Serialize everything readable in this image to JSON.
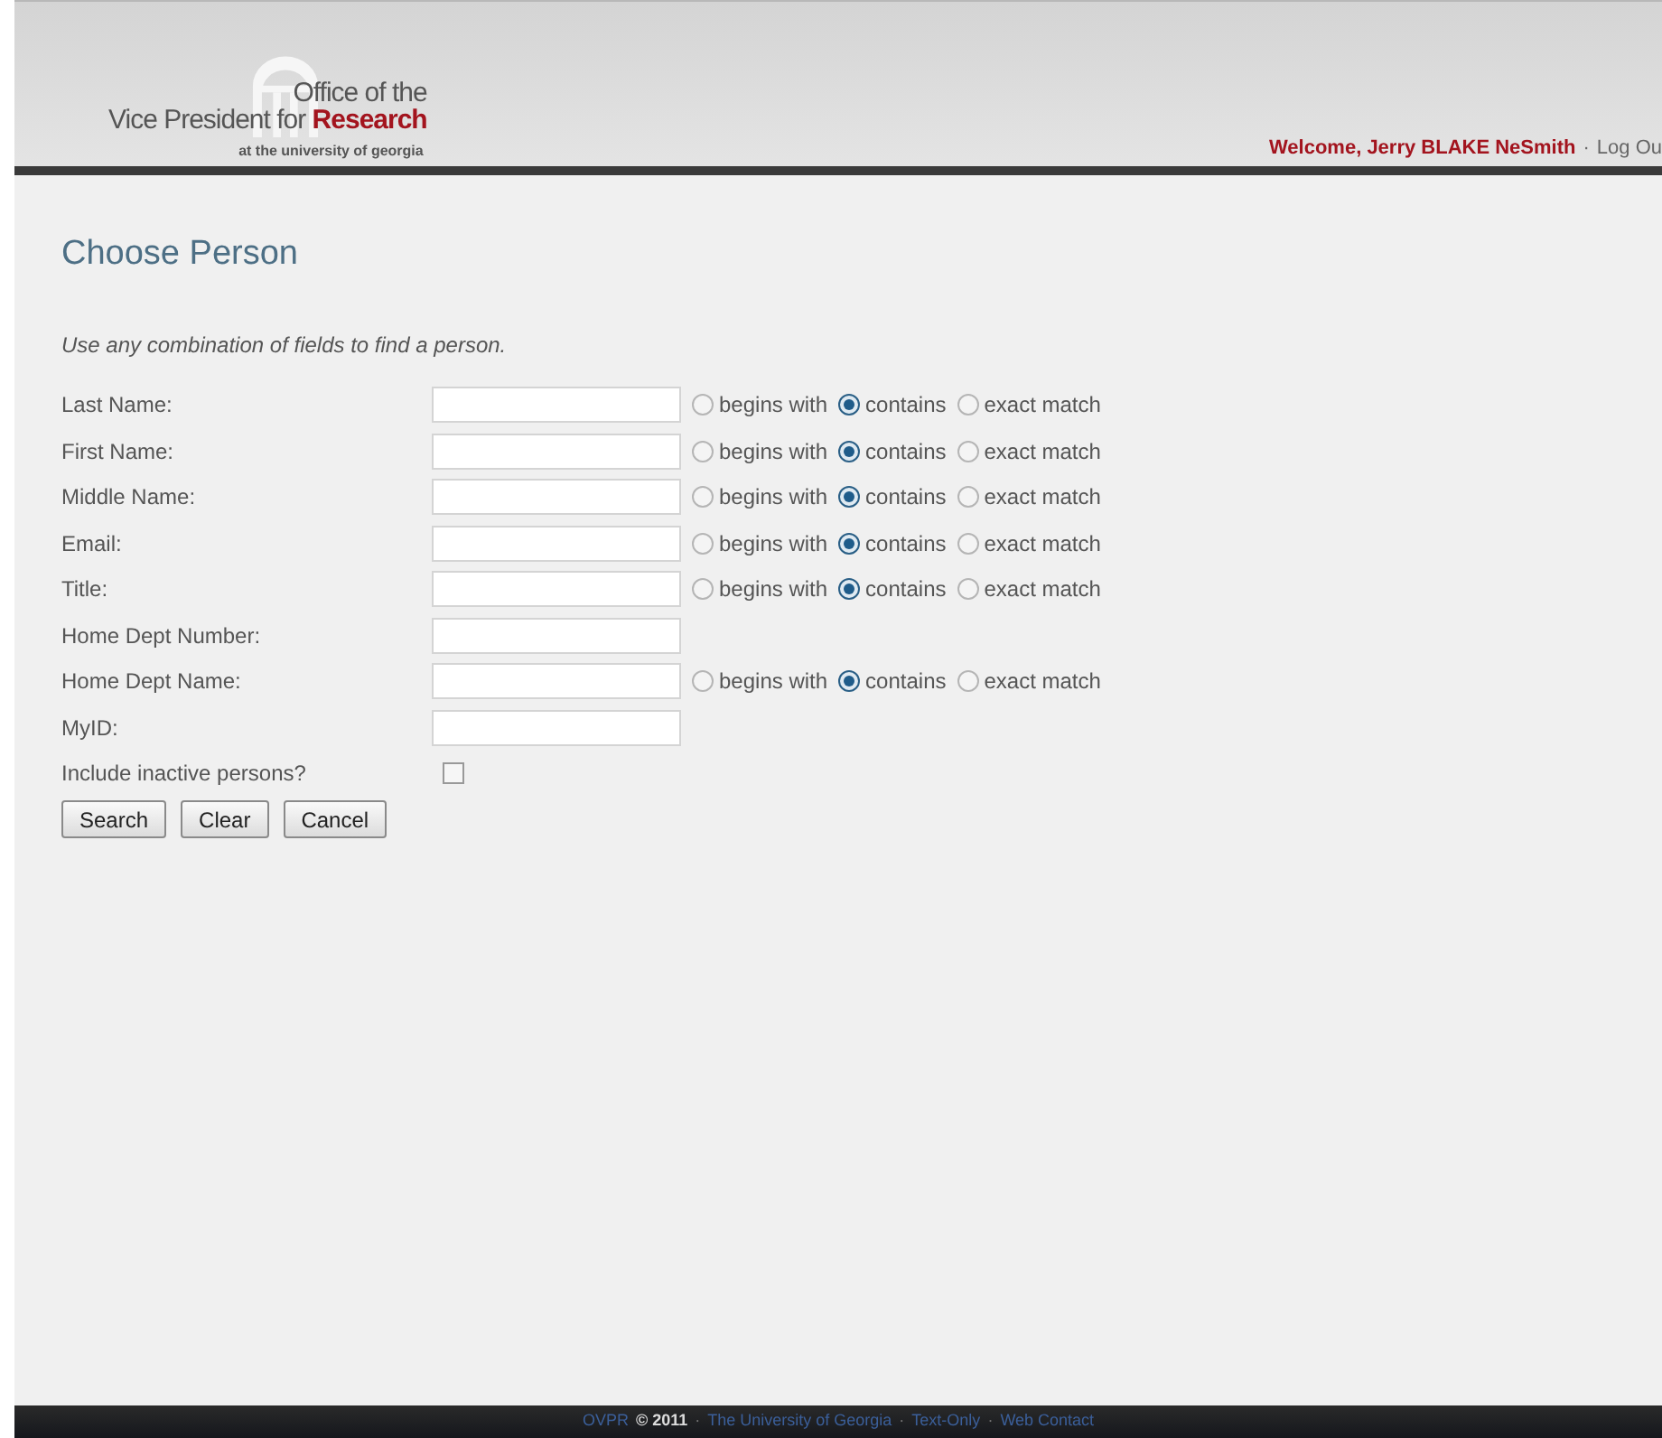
{
  "header": {
    "logo": {
      "line1": "Office of the",
      "line2": "Vice President for **Research**",
      "line3": "at the university of georgia"
    },
    "welcome": "Welcome, Jerry BLAKE NeSmith",
    "separator": "·",
    "logout": "Log Ou"
  },
  "title": "Choose Person",
  "intro": "Use any combination of fields to find a person.",
  "fields": [
    {
      "label": "Last Name:",
      "kind": "text",
      "options": [
        {
          "label": "begins with",
          "selected": false
        },
        {
          "label": "contains",
          "selected": true
        },
        {
          "label": "exact match",
          "selected": false
        }
      ]
    },
    {
      "label": "First Name:",
      "kind": "text",
      "options": [
        {
          "label": "begins with",
          "selected": false
        },
        {
          "label": "contains",
          "selected": true
        },
        {
          "label": "exact match",
          "selected": false
        }
      ]
    },
    {
      "label": "Middle Name:",
      "kind": "text",
      "options": [
        {
          "label": "begins with",
          "selected": false
        },
        {
          "label": "contains",
          "selected": true
        },
        {
          "label": "exact match",
          "selected": false
        }
      ]
    },
    {
      "label": "Email:",
      "kind": "text",
      "options": [
        {
          "label": "begins with",
          "selected": false
        },
        {
          "label": "contains",
          "selected": true
        },
        {
          "label": "exact match",
          "selected": false
        }
      ]
    },
    {
      "label": "Title:",
      "kind": "text",
      "options": [
        {
          "label": "begins with",
          "selected": false
        },
        {
          "label": "contains",
          "selected": true
        },
        {
          "label": "exact match",
          "selected": false
        }
      ]
    },
    {
      "label": "Home Dept Number:",
      "kind": "text"
    },
    {
      "label": "Home Dept Name:",
      "kind": "text",
      "options": [
        {
          "label": "begins with",
          "selected": false
        },
        {
          "label": "contains",
          "selected": true
        },
        {
          "label": "exact match",
          "selected": false
        }
      ]
    },
    {
      "label": "MyID:",
      "kind": "text"
    },
    {
      "label": "Include inactive persons?",
      "kind": "checkbox",
      "checked": false
    }
  ],
  "buttons": [
    "Search",
    "Clear",
    "Cancel"
  ],
  "footer": {
    "brand": "OVPR",
    "copyright": "© 2011",
    "separator": "·",
    "links": [
      "The University of Georgia",
      "Text-Only",
      "Web Contact"
    ]
  }
}
